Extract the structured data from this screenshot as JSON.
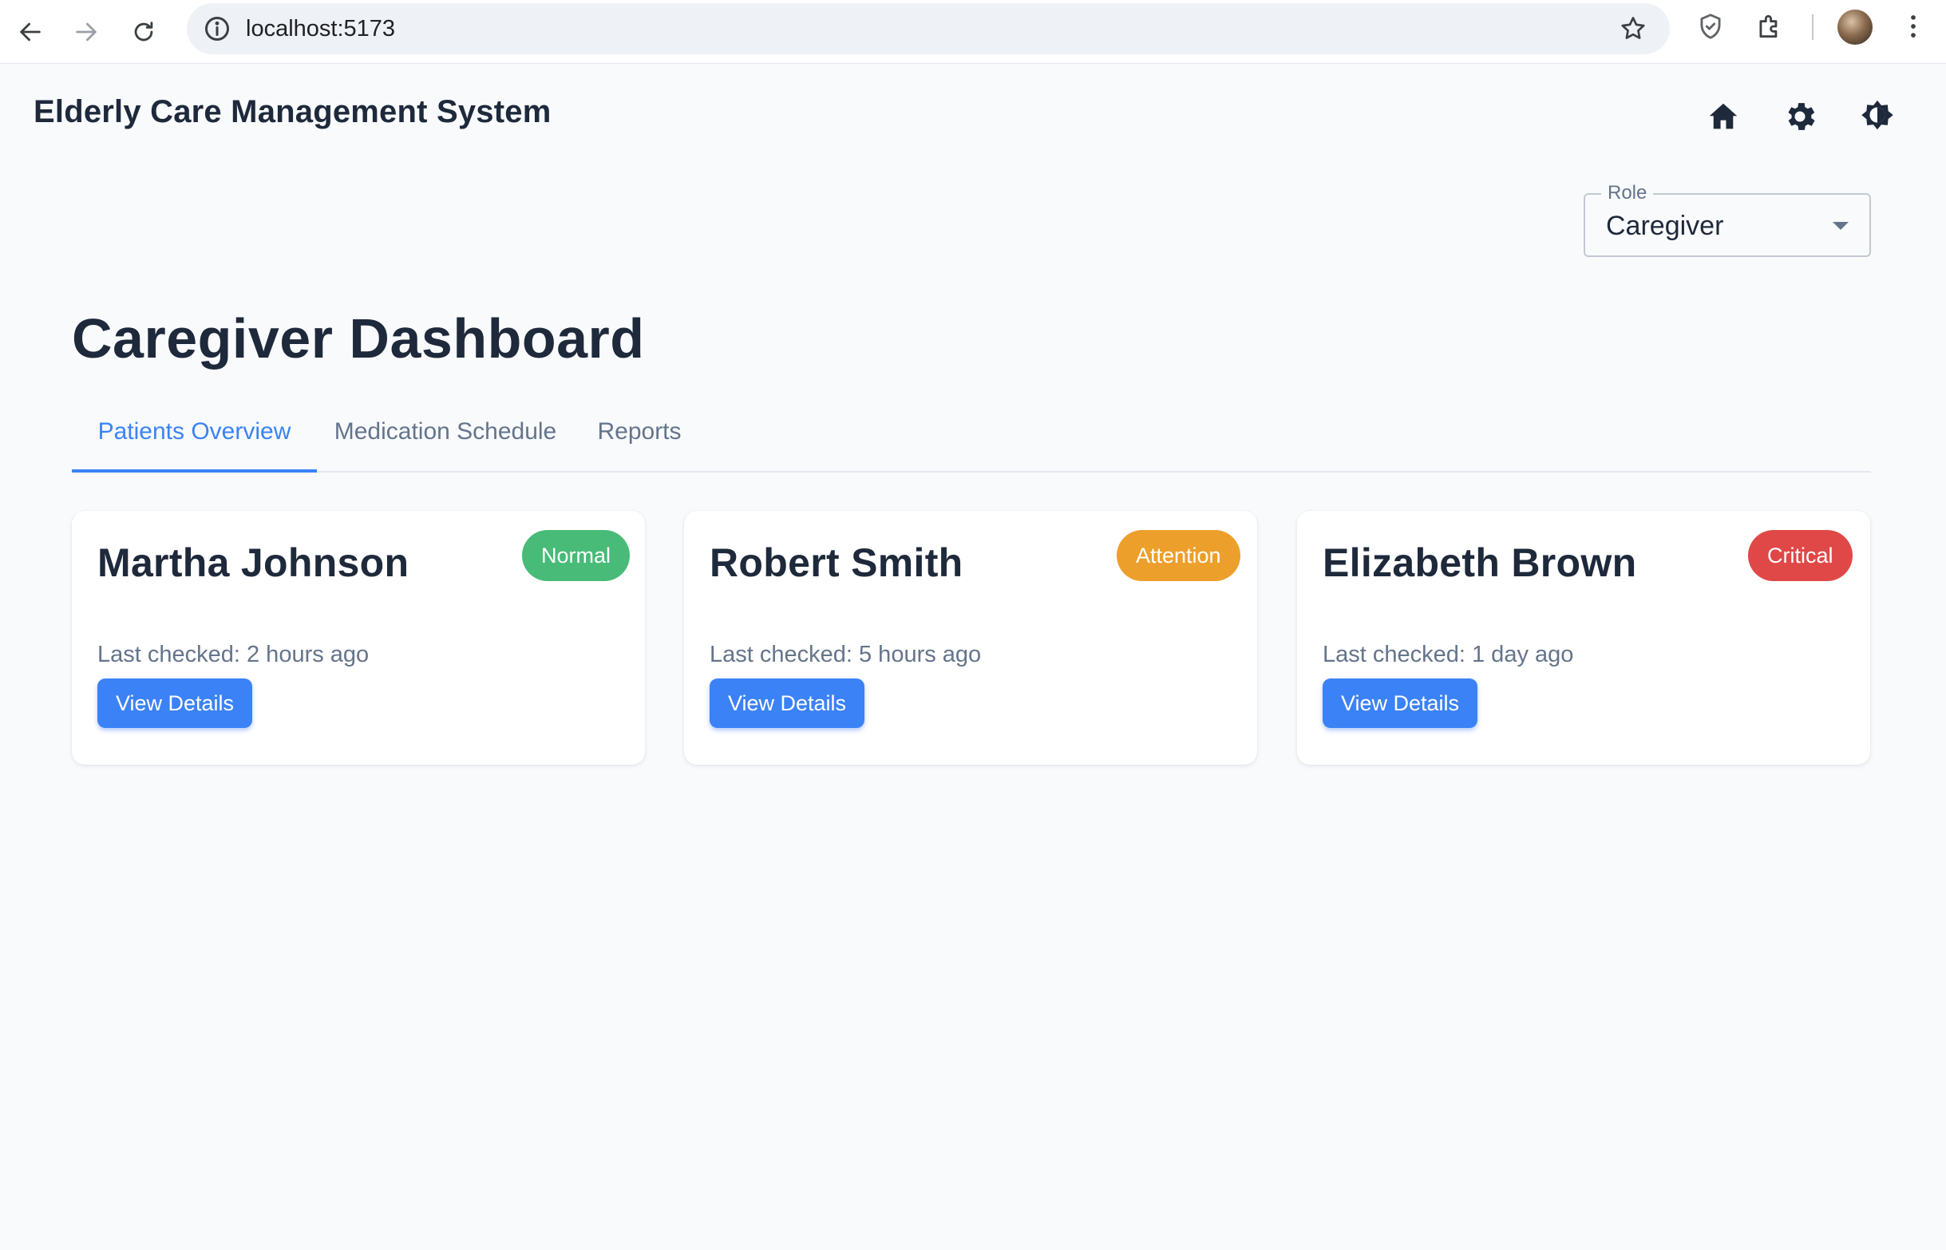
{
  "browser": {
    "url": "localhost:5173"
  },
  "app": {
    "title": "Elderly Care Management System",
    "header_icons": [
      "home-icon",
      "gear-icon",
      "theme-toggle-icon"
    ]
  },
  "role_select": {
    "label": "Role",
    "value": "Caregiver"
  },
  "page": {
    "title": "Caregiver Dashboard"
  },
  "tabs": [
    {
      "label": "Patients Overview",
      "active": true
    },
    {
      "label": "Medication Schedule",
      "active": false
    },
    {
      "label": "Reports",
      "active": false
    }
  ],
  "patients": [
    {
      "name": "Martha Johnson",
      "status": "Normal",
      "status_color": "#48bb78",
      "last_checked": "Last checked: 2 hours ago",
      "button": "View Details"
    },
    {
      "name": "Robert Smith",
      "status": "Attention",
      "status_color": "#ed9f2b",
      "last_checked": "Last checked: 5 hours ago",
      "button": "View Details"
    },
    {
      "name": "Elizabeth Brown",
      "status": "Critical",
      "status_color": "#e04848",
      "last_checked": "Last checked: 1 day ago",
      "button": "View Details"
    }
  ],
  "colors": {
    "accent": "#3b82f6",
    "background": "#f8fafc",
    "text": "#1e293b",
    "muted": "#64748b"
  }
}
